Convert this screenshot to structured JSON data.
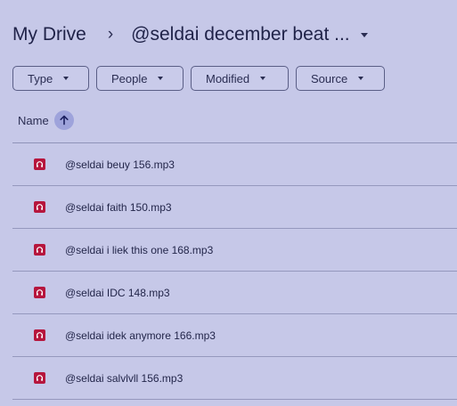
{
  "breadcrumb": {
    "root": "My Drive",
    "separator": "›",
    "current": "@seldai december beat ..."
  },
  "filters": [
    {
      "label": "Type"
    },
    {
      "label": "People"
    },
    {
      "label": "Modified"
    },
    {
      "label": "Source"
    }
  ],
  "list_header": {
    "name_label": "Name",
    "sort_icon": "arrow-up-icon"
  },
  "files": [
    {
      "name": "@seldai beuy 156.mp3",
      "icon": "audio-file-icon"
    },
    {
      "name": "@seldai faith 150.mp3",
      "icon": "audio-file-icon"
    },
    {
      "name": "@seldai i liek this one 168.mp3",
      "icon": "audio-file-icon"
    },
    {
      "name": "@seldai IDC 148.mp3",
      "icon": "audio-file-icon"
    },
    {
      "name": "@seldai idek anymore 166.mp3",
      "icon": "audio-file-icon"
    },
    {
      "name": "@seldai salvlvll 156.mp3",
      "icon": "audio-file-icon"
    }
  ],
  "colors": {
    "background": "#c6c8e8",
    "audio_icon": "#b6163d",
    "sort_button": "#9ea3db"
  }
}
